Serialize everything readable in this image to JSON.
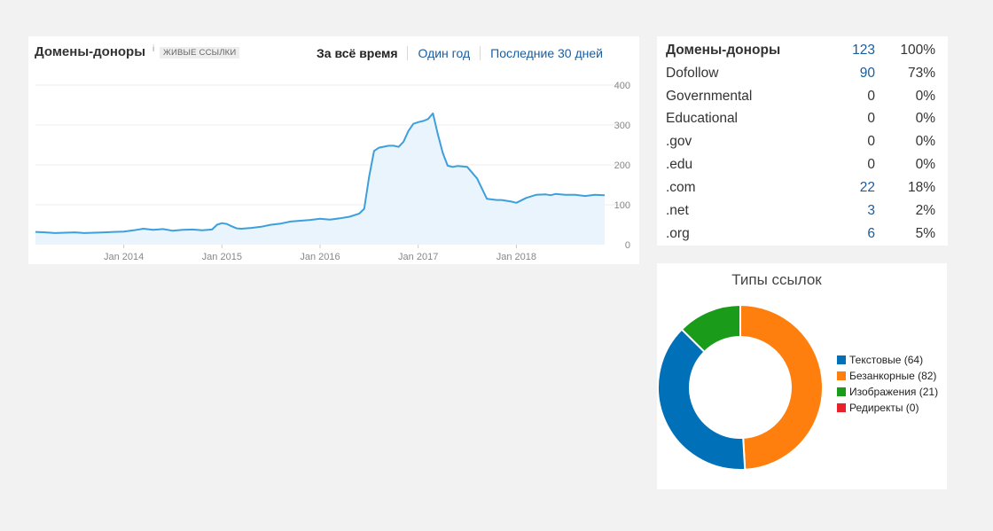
{
  "chart_panel": {
    "title": "Домены-доноры",
    "info": "i",
    "badge": "ЖИВЫЕ ССЫЛКИ",
    "tabs": [
      {
        "label": "За всё время",
        "active": true
      },
      {
        "label": "Один год",
        "active": false
      },
      {
        "label": "Последние 30 дней",
        "active": false
      }
    ]
  },
  "chart_data": {
    "type": "area",
    "title": "",
    "xlabel": "",
    "ylabel": "",
    "x_range": [
      2013.1,
      2018.9
    ],
    "ylim": [
      0,
      400
    ],
    "yticks": [
      "400",
      "300",
      "200",
      "100",
      "0"
    ],
    "xticks": [
      "Jan 2014",
      "Jan 2015",
      "Jan 2016",
      "Jan 2017",
      "Jan 2018"
    ],
    "grid": true,
    "colors": {
      "line": "#3d9fdb",
      "fill": "#eaf4fc"
    },
    "series": [
      {
        "x": [
          2013.1,
          2013.2,
          2013.3,
          2013.4,
          2013.5,
          2013.6,
          2013.7,
          2013.8,
          2013.9,
          2014.0,
          2014.1,
          2014.2,
          2014.3,
          2014.4,
          2014.5,
          2014.6,
          2014.7,
          2014.8,
          2014.9,
          2014.95,
          2015.0,
          2015.05,
          2015.1,
          2015.15,
          2015.2,
          2015.3,
          2015.4,
          2015.5,
          2015.6,
          2015.7,
          2015.8,
          2015.9,
          2016.0,
          2016.1,
          2016.2,
          2016.3,
          2016.4,
          2016.45,
          2016.5,
          2016.55,
          2016.6,
          2016.7,
          2016.75,
          2016.8,
          2016.85,
          2016.9,
          2016.95,
          2017.0,
          2017.05,
          2017.1,
          2017.15,
          2017.2,
          2017.25,
          2017.3,
          2017.35,
          2017.4,
          2017.5,
          2017.6,
          2017.7,
          2017.8,
          2017.85,
          2017.9,
          2017.95,
          2018.0,
          2018.1,
          2018.2,
          2018.3,
          2018.35,
          2018.4,
          2018.5,
          2018.6,
          2018.7,
          2018.8,
          2018.9
        ],
        "values": [
          32,
          31,
          29,
          30,
          31,
          29,
          30,
          31,
          32,
          33,
          36,
          40,
          37,
          39,
          35,
          37,
          38,
          36,
          38,
          50,
          54,
          52,
          46,
          41,
          40,
          42,
          45,
          50,
          53,
          58,
          60,
          62,
          65,
          63,
          66,
          70,
          78,
          90,
          170,
          235,
          243,
          248,
          248,
          245,
          258,
          285,
          303,
          307,
          310,
          315,
          329,
          277,
          230,
          198,
          195,
          197,
          195,
          166,
          115,
          112,
          112,
          110,
          108,
          105,
          117,
          125,
          126,
          124,
          127,
          125,
          125,
          122,
          125,
          124
        ]
      }
    ]
  },
  "stats": {
    "rows": [
      {
        "label": "Домены-доноры",
        "count": "123",
        "pct": "100%",
        "link": true,
        "header": true
      },
      {
        "label": "Dofollow",
        "count": "90",
        "pct": "73%",
        "link": true,
        "header": false
      },
      {
        "label": "Governmental",
        "count": "0",
        "pct": "0%",
        "link": false,
        "header": false
      },
      {
        "label": "Educational",
        "count": "0",
        "pct": "0%",
        "link": false,
        "header": false
      },
      {
        "label": ".gov",
        "count": "0",
        "pct": "0%",
        "link": false,
        "header": false
      },
      {
        "label": ".edu",
        "count": "0",
        "pct": "0%",
        "link": false,
        "header": false
      },
      {
        "label": ".com",
        "count": "22",
        "pct": "18%",
        "link": true,
        "header": false
      },
      {
        "label": ".net",
        "count": "3",
        "pct": "2%",
        "link": true,
        "header": false
      },
      {
        "label": ".org",
        "count": "6",
        "pct": "5%",
        "link": true,
        "header": false
      }
    ]
  },
  "link_types": {
    "title": "Типы ссылок",
    "slices": [
      {
        "label": "Безанкорные (82)",
        "value": 82,
        "color": "#ff7f0e"
      },
      {
        "label": "Текстовые (64)",
        "value": 64,
        "color": "#0070b8"
      },
      {
        "label": "Изображения (21)",
        "value": 21,
        "color": "#1a9c1a"
      },
      {
        "label": "Редиректы (0)",
        "value": 0,
        "color": "#e8212a"
      }
    ],
    "legend": [
      {
        "label": "Текстовые (64)",
        "color": "#0070b8"
      },
      {
        "label": "Безанкорные (82)",
        "color": "#ff7f0e"
      },
      {
        "label": "Изображения (21)",
        "color": "#1a9c1a"
      },
      {
        "label": "Редиректы (0)",
        "color": "#e8212a"
      }
    ]
  }
}
